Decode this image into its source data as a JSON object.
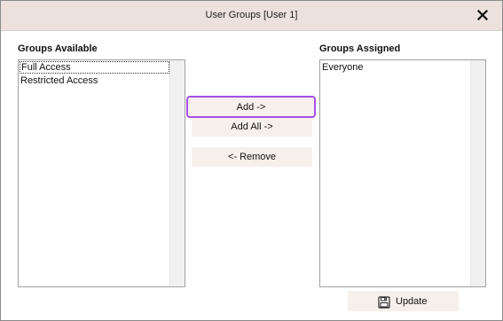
{
  "window": {
    "title": "User Groups [User 1]",
    "close_icon": "close-icon"
  },
  "available": {
    "label": "Groups Available",
    "items": [
      "Full Access",
      "Restricted Access"
    ],
    "focused_index": 0
  },
  "assigned": {
    "label": "Groups Assigned",
    "items": [
      "Everyone"
    ]
  },
  "buttons": {
    "add": "Add ->",
    "add_all": "Add All ->",
    "remove": "<- Remove",
    "update": "Update",
    "update_icon": "save-disk-icon"
  },
  "colors": {
    "titlebar": "#ece1dc",
    "button_bg": "#f6f0ec",
    "highlight_border": "#a64ee6"
  }
}
